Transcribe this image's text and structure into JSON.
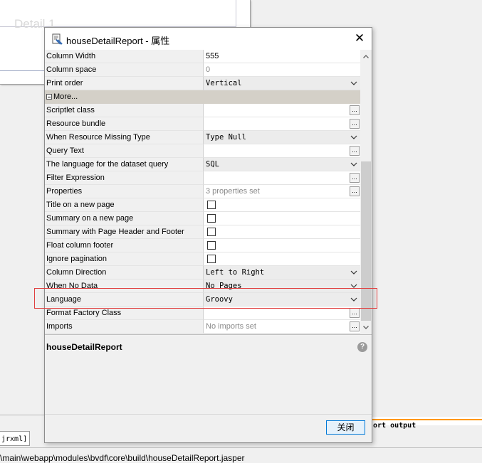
{
  "background": {
    "band_title": "Detail 1",
    "output_label": "ort output",
    "tab_label": "jrxml]",
    "status_path": "\\main\\webapp\\modules\\bvdf\\core\\build\\houseDetailReport.jasper"
  },
  "dialog": {
    "title": "houseDetailReport - 属性",
    "close_glyph": "✕",
    "ok_label": "关闭",
    "description_title": "houseDetailReport",
    "help_glyph": "?"
  },
  "properties": [
    {
      "name": "Column Width",
      "kind": "text",
      "value": "555"
    },
    {
      "name": "Column space",
      "kind": "text",
      "value": "0",
      "muted": true
    },
    {
      "name": "Print order",
      "kind": "combo",
      "value": "Vertical"
    },
    {
      "name": "More...",
      "kind": "section"
    },
    {
      "name": "Scriptlet class",
      "kind": "dots",
      "value": ""
    },
    {
      "name": "Resource bundle",
      "kind": "dots",
      "value": ""
    },
    {
      "name": "When Resource Missing Type",
      "kind": "combo",
      "value": "Type Null"
    },
    {
      "name": "Query Text",
      "kind": "dots",
      "value": ""
    },
    {
      "name": "The language for the dataset query",
      "kind": "combo",
      "value": "SQL"
    },
    {
      "name": "Filter Expression",
      "kind": "dots",
      "value": ""
    },
    {
      "name": "Properties",
      "kind": "dots",
      "value": "3 properties set",
      "muted": true
    },
    {
      "name": "Title on a new page",
      "kind": "check",
      "checked": false
    },
    {
      "name": "Summary on a new page",
      "kind": "check",
      "checked": false
    },
    {
      "name": "Summary with Page Header and Footer",
      "kind": "check",
      "checked": false
    },
    {
      "name": "Float column footer",
      "kind": "check",
      "checked": false
    },
    {
      "name": "Ignore pagination",
      "kind": "check",
      "checked": false
    },
    {
      "name": "Column Direction",
      "kind": "combo",
      "value": "Left to Right"
    },
    {
      "name": "When No Data",
      "kind": "combo",
      "value": "No Pages"
    },
    {
      "name": "Language",
      "kind": "combo",
      "value": "Groovy"
    },
    {
      "name": "Format Factory Class",
      "kind": "dots",
      "value": ""
    },
    {
      "name": "Imports",
      "kind": "dots",
      "value": "No imports set",
      "muted": true
    }
  ],
  "colors": {
    "highlight": "#e04040",
    "section_bg": "#d4d0c8",
    "ok_border": "#0078d7",
    "output_line": "#ff9800"
  }
}
